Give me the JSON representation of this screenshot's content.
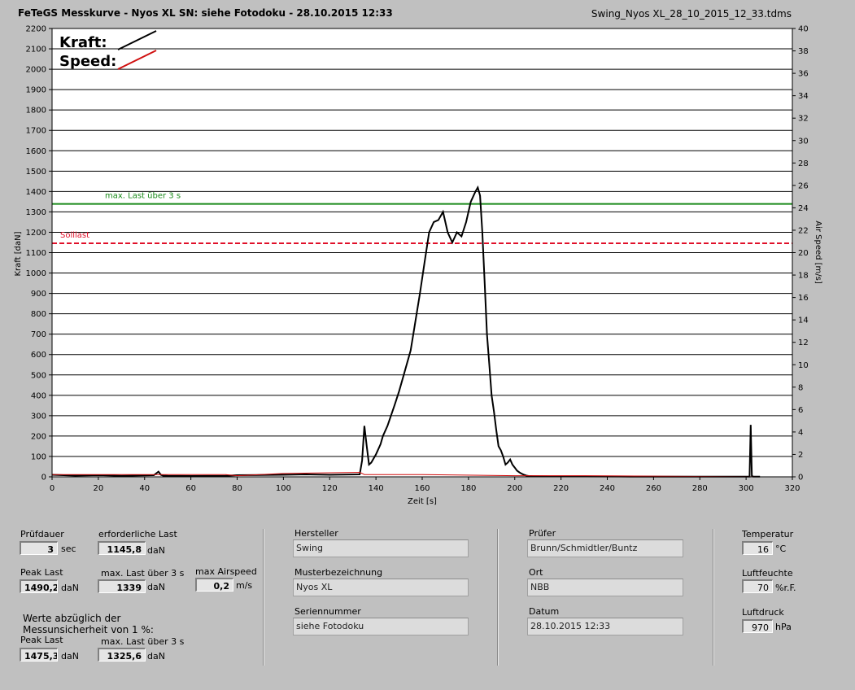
{
  "header": {
    "title": "FeTeGS Messkurve - Nyos XL  SN: siehe Fotodoku - 28.10.2015 12:33",
    "filename": "Swing_Nyos XL_28_10_2015_12_33.tdms"
  },
  "chart_data": {
    "type": "line",
    "x_axis": {
      "label": "Zeit [s]",
      "range": [
        0,
        320
      ],
      "ticks": [
        0,
        20,
        40,
        60,
        80,
        100,
        120,
        140,
        160,
        180,
        200,
        220,
        240,
        260,
        280,
        300,
        320
      ]
    },
    "y_left": {
      "label": "Kraft [daN]",
      "range": [
        0,
        2200
      ],
      "ticks": [
        0,
        100,
        200,
        300,
        400,
        500,
        600,
        700,
        800,
        900,
        1000,
        1100,
        1200,
        1300,
        1400,
        1500,
        1600,
        1700,
        1800,
        1900,
        2000,
        2100,
        2200
      ]
    },
    "y_right": {
      "label": "Air Speed [m/s]",
      "range": [
        0,
        40
      ],
      "ticks": [
        0,
        2,
        4,
        6,
        8,
        10,
        12,
        14,
        16,
        18,
        20,
        22,
        24,
        26,
        28,
        30,
        32,
        34,
        36,
        38,
        40
      ]
    },
    "grid": "horizontal",
    "legend": {
      "position": "top-left",
      "entries": [
        {
          "label": "Kraft:",
          "color": "#000000"
        },
        {
          "label": "Speed:",
          "color": "#d01010"
        }
      ]
    },
    "reference_lines": [
      {
        "label": "max. Last über  3 s",
        "y": 1339,
        "color": "#1a8a1a",
        "style": "solid"
      },
      {
        "label": "Solllast",
        "y": 1145.8,
        "color": "#e0102a",
        "style": "dashed"
      }
    ],
    "series": [
      {
        "name": "Kraft:",
        "color": "#000000",
        "x": [
          0,
          10,
          20,
          30,
          44,
          46,
          47,
          48,
          50,
          60,
          75,
          80,
          100,
          110,
          120,
          133,
          134,
          135,
          136,
          137,
          138,
          140,
          142,
          143,
          145,
          148,
          150,
          152,
          155,
          157,
          159,
          161,
          163,
          165,
          167,
          169,
          171,
          173,
          175,
          177,
          179,
          181,
          183,
          184,
          185,
          186,
          187,
          188,
          189,
          190,
          191,
          192,
          193,
          194,
          195,
          196,
          197,
          198,
          199,
          200,
          201,
          202,
          203,
          204,
          205,
          206,
          208,
          215,
          230,
          250,
          270,
          290,
          300,
          301.5,
          302,
          302.5,
          303,
          306
        ],
        "y": [
          10,
          6,
          8,
          5,
          8,
          25,
          10,
          6,
          5,
          4,
          5,
          8,
          10,
          12,
          10,
          12,
          80,
          250,
          150,
          60,
          70,
          110,
          160,
          200,
          250,
          350,
          420,
          500,
          620,
          760,
          900,
          1050,
          1200,
          1250,
          1260,
          1300,
          1200,
          1150,
          1200,
          1180,
          1250,
          1350,
          1400,
          1420,
          1380,
          1200,
          950,
          700,
          550,
          400,
          320,
          230,
          150,
          130,
          100,
          60,
          70,
          85,
          60,
          45,
          30,
          22,
          15,
          10,
          6,
          4,
          3,
          2,
          2,
          1,
          1,
          1,
          1,
          1,
          255,
          5,
          1,
          1
        ]
      },
      {
        "name": "Speed:",
        "color": "#d01010",
        "x": [
          0,
          75,
          80,
          100,
          133,
          135,
          160,
          200,
          230,
          306
        ],
        "y": [
          0.2,
          0.2,
          0.1,
          0.3,
          0.4,
          0.2,
          0.2,
          0.1,
          0.1,
          0.0
        ]
      }
    ]
  },
  "panel": {
    "pruefdauer": {
      "label": "Prüfdauer",
      "value": "3",
      "unit": "sec"
    },
    "erforderliche_last": {
      "label": "erforderliche Last",
      "value": "1145,8",
      "unit": "daN"
    },
    "peak_last": {
      "label": "Peak Last",
      "value": "1490,2",
      "unit": "daN"
    },
    "max_last_3s": {
      "label": "max. Last über  3 s",
      "value": "1339",
      "unit": "daN"
    },
    "max_airspeed": {
      "label": "max Airspeed",
      "value": "0,2",
      "unit": "m/s"
    },
    "werte_note_line1": "Werte abzüglich der",
    "werte_note_line2": "Messunsicherheit von 1  %:",
    "peak_last_corr": {
      "label": "Peak Last",
      "value": "1475,3",
      "unit": "daN"
    },
    "max_last_3s_corr": {
      "label": "max. Last über  3 s",
      "value": "1325,6",
      "unit": "daN"
    },
    "hersteller": {
      "label": "Hersteller",
      "value": "Swing"
    },
    "musterbezeichnung": {
      "label": "Musterbezeichnung",
      "value": "Nyos XL"
    },
    "seriennummer": {
      "label": "Seriennummer",
      "value": "siehe Fotodoku"
    },
    "pruefer": {
      "label": "Prüfer",
      "value": "Brunn/Schmidtler/Buntz"
    },
    "ort": {
      "label": "Ort",
      "value": "NBB"
    },
    "datum": {
      "label": "Datum",
      "value": "28.10.2015 12:33"
    },
    "temperatur": {
      "label": "Temperatur",
      "value": "16",
      "unit": "°C"
    },
    "luftfeuchte": {
      "label": "Luftfeuchte",
      "value": "70",
      "unit": "%r.F."
    },
    "luftdruck": {
      "label": "Luftdruck",
      "value": "970",
      "unit": "hPa"
    }
  }
}
